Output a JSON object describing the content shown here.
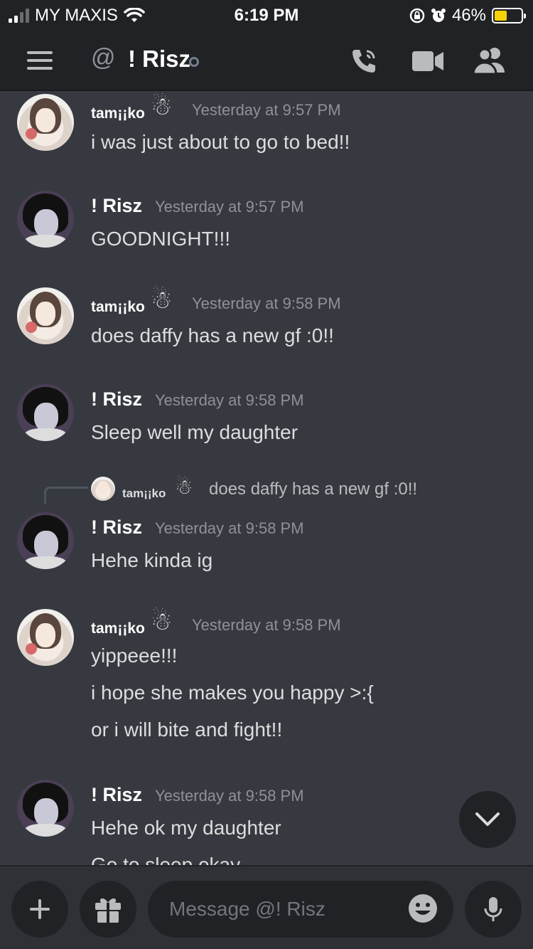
{
  "status_bar": {
    "carrier": "MY MAXIS",
    "time": "6:19 PM",
    "battery_level": 46,
    "battery_text": "46%"
  },
  "header": {
    "channel_name": "! Risz",
    "icons": [
      "menu-icon",
      "at-icon",
      "call-icon",
      "video-icon",
      "members-icon"
    ]
  },
  "messages": [
    {
      "username": "tam¡¡ko",
      "decoration": "☃",
      "timestamp": "Yesterday at 9:57 PM",
      "lines": [
        "i was just about to go to bed!!"
      ]
    },
    {
      "username": "! Risz",
      "timestamp": "Yesterday at 9:57 PM",
      "lines": [
        "GOODNIGHT!!!"
      ]
    },
    {
      "username": "tam¡¡ko",
      "decoration": "☃",
      "timestamp": "Yesterday at 9:58 PM",
      "lines": [
        "does daffy has a new gf :0!!"
      ]
    },
    {
      "username": "! Risz",
      "timestamp": "Yesterday at 9:58 PM",
      "lines": [
        "Sleep well my daughter"
      ]
    },
    {
      "reply": {
        "username": "tam¡¡ko",
        "decoration": "☃",
        "text": "does daffy has a new gf :0!!"
      },
      "username": "! Risz",
      "timestamp": "Yesterday at 9:58 PM",
      "lines": [
        "Hehe kinda ig"
      ]
    },
    {
      "username": "tam¡¡ko",
      "decoration": "☃",
      "timestamp": "Yesterday at 9:58 PM",
      "lines": [
        "yippeee!!!",
        "i hope she makes you happy >:{",
        "or i will bite and fight!!"
      ]
    },
    {
      "username": "! Risz",
      "timestamp": "Yesterday at 9:58 PM",
      "lines": [
        "Hehe ok my daughter",
        "Go to sleep okay"
      ]
    }
  ],
  "composer": {
    "placeholder": "Message @! Risz"
  },
  "colors": {
    "background": "#36393f",
    "header": "#202225",
    "username": "#ffffff",
    "timestamp": "#8e9297",
    "text": "#dcddde"
  }
}
